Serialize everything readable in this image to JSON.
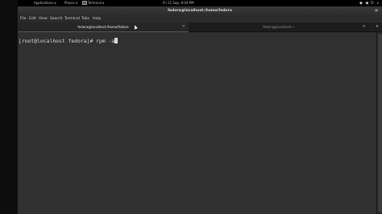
{
  "top_panel": {
    "applications_label": "Applications",
    "places_label": "Places",
    "terminal_label": "Terminal",
    "datetime": "Fri 11 Sep,  9:04 PM",
    "status_icons": [
      "network-icon",
      "volume-icon",
      "power-icon"
    ]
  },
  "window": {
    "title": "fedora@localhost:/home/fedora",
    "close_glyph": "✕"
  },
  "menubar": {
    "items": [
      "File",
      "Edit",
      "View",
      "Search",
      "Terminal",
      "Tabs",
      "Help"
    ]
  },
  "tabs": [
    {
      "label": "fedora@localhost:/home/fedora",
      "active": true
    },
    {
      "label": "fedora@localhost:~",
      "active": false
    }
  ],
  "terminal": {
    "prompt": "[root@localhost fedora]# ",
    "command": "rpm -a"
  },
  "colors": {
    "terminal_bg": "#303030",
    "text": "#d9d9d9",
    "panel_bg": "#000000"
  }
}
